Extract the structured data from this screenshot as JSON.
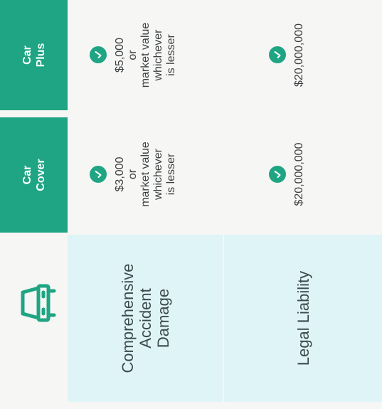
{
  "columns": [
    {
      "header": "Car\nCover"
    },
    {
      "header": "Car\nPlus"
    }
  ],
  "rows": [
    {
      "label": "Comprehensive\nAccident\nDamage",
      "values": [
        "$3,000\nor\nmarket value\nwhichever\nis lesser",
        "$5,000\nor\nmarket value\nwhichever\nis lesser"
      ]
    },
    {
      "label": "Legal Liability",
      "values": [
        "$20,000,000",
        "$20,000,000"
      ]
    }
  ],
  "icon": "car-front-icon",
  "colors": {
    "accent": "#1fa583",
    "label_bg": "#def4f6",
    "text": "#3d4a4d"
  }
}
